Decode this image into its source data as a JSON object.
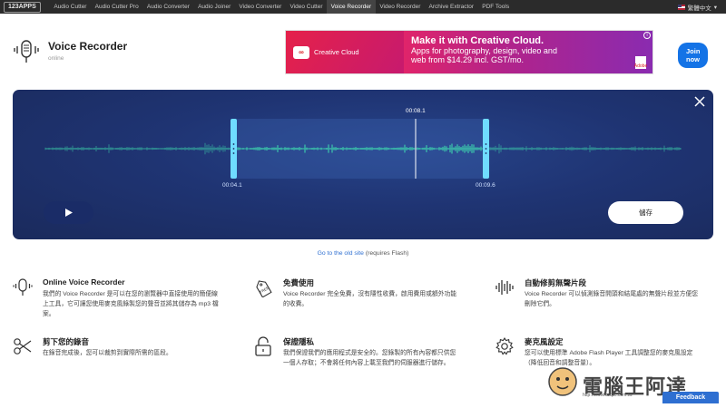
{
  "nav": {
    "logo": "123APPS",
    "items": [
      "Audio Cutter",
      "Audio Cutter Pro",
      "Audio Converter",
      "Audio Joiner",
      "Video Converter",
      "Video Cutter",
      "Voice Recorder",
      "Video Recorder",
      "Archive Extractor",
      "PDF Tools"
    ],
    "active": "Voice Recorder",
    "language": "繁體中文"
  },
  "header": {
    "title": "Voice Recorder",
    "status": "online"
  },
  "ad": {
    "brand": "Creative Cloud",
    "headline": "Make it with Creative Cloud.",
    "copy": "Apps for photography, design, video and web from $14.29 incl. GST/mo.",
    "button": "Join now",
    "adobe": "Adobe"
  },
  "recorder": {
    "current_time": "00:08.1",
    "start_time": "00:04.1",
    "end_time": "00:09.6",
    "save_label": "儲存",
    "accent": "#3ee0b0"
  },
  "old_site": {
    "link": "Go to the old site",
    "suffix": " (requires Flash)"
  },
  "features": [
    {
      "icon": "microphone-icon",
      "title": "Online Voice Recorder",
      "desc": "我們的 Voice Recorder 是可以在您的瀏覽器中直接使用的簡便線上工具，它可讓您使用麥克風錄製您的聲音並將其儲存為 mp3 檔案。"
    },
    {
      "icon": "free-tag-icon",
      "title": "免費使用",
      "desc": "Voice Recorder 完全免費，沒有隱性收費，啟用費用或額外功能的收費。"
    },
    {
      "icon": "waveform-icon",
      "title": "自動修剪無聲片段",
      "desc": "Voice Recorder 可以偵測錄音開頭和結尾處的無聲片段並方便您刪除它們。"
    },
    {
      "icon": "scissors-icon",
      "title": "剪下您的錄音",
      "desc": "在錄音完成後，您可以裁剪到實際所需的區段。"
    },
    {
      "icon": "lock-icon",
      "title": "保證隱私",
      "desc": "我們保證我們的應用程式是安全的。您錄製的所有內容都只供您一個人存取；不會將任何內容上載至我們的伺服器進行儲存。"
    },
    {
      "icon": "gear-icon",
      "title": "麥克風設定",
      "desc": "您可以使用標準 Adobe Flash Player 工具調整您的麥克風設定（降低回音和調整音量）。"
    }
  ],
  "watermark": {
    "text": "電腦王阿達",
    "url": "http://www.kocpc.com.tw"
  },
  "feedback": "Feedback"
}
